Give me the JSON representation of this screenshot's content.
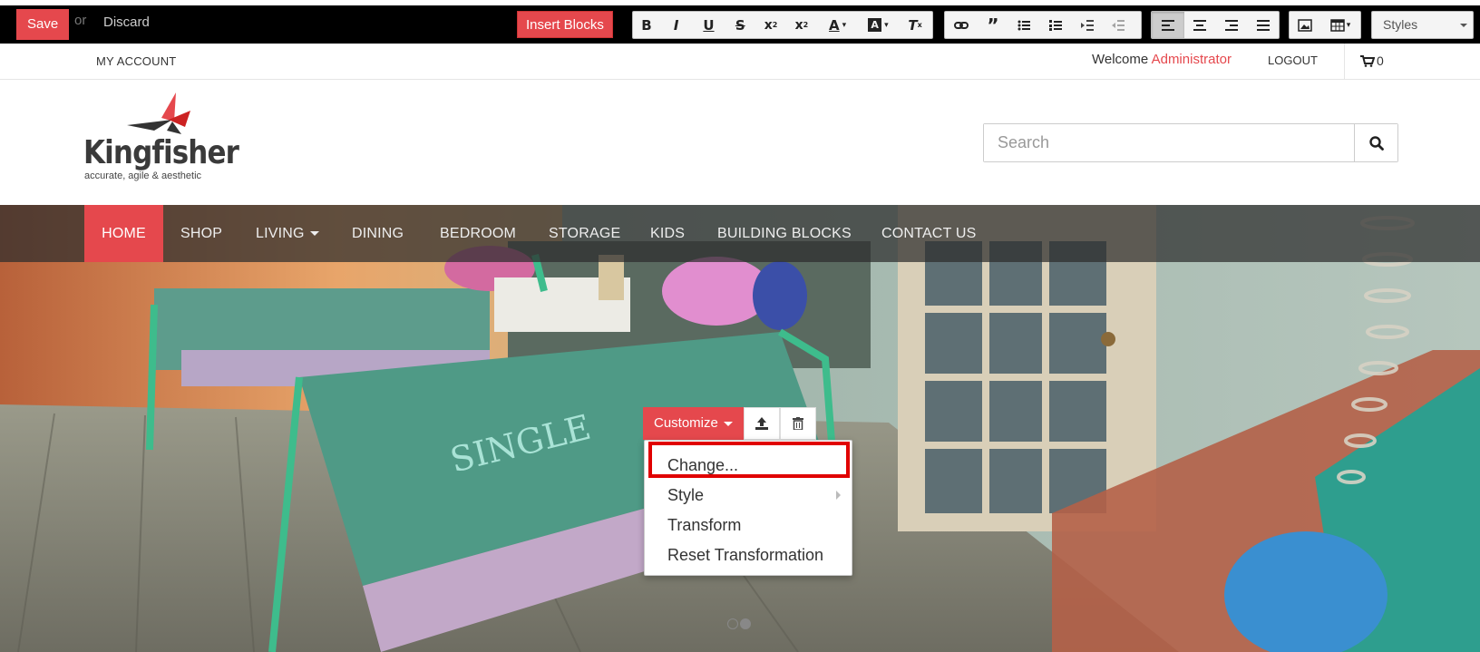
{
  "editor": {
    "save_label": "Save",
    "or_label": "or",
    "discard_label": "Discard",
    "insert_blocks_label": "Insert Blocks",
    "styles_label": "Styles",
    "format_icons": [
      "bold-icon",
      "italic-icon",
      "underline-icon",
      "strikethrough-icon",
      "subscript-icon",
      "superscript-icon",
      "font-color-icon",
      "background-color-icon",
      "remove-format-icon",
      "link-icon",
      "blockquote-icon",
      "bulleted-list-icon",
      "numbered-list-icon",
      "indent-icon",
      "outdent-icon",
      "align-left-icon",
      "align-center-icon",
      "align-right-icon",
      "justify-icon",
      "image-icon",
      "table-icon"
    ]
  },
  "account": {
    "my_account_label": "MY ACCOUNT",
    "welcome_label": "Welcome",
    "user_name": "Administrator",
    "logout_label": "LOGOUT",
    "cart_count": "0"
  },
  "brand": {
    "name": "Kingfisher",
    "tagline": "accurate, agile & aesthetic",
    "accent_color": "#e5484d"
  },
  "search": {
    "placeholder": "Search"
  },
  "nav": {
    "items": [
      {
        "label": "HOME",
        "active": true
      },
      {
        "label": "SHOP"
      },
      {
        "label": "LIVING",
        "has_dropdown": true
      },
      {
        "label": "DINING"
      },
      {
        "label": "BEDROOM"
      },
      {
        "label": "STORAGE"
      },
      {
        "label": "KIDS"
      },
      {
        "label": "BUILDING BLOCKS"
      },
      {
        "label": "CONTACT US"
      }
    ]
  },
  "customize": {
    "button_label": "Customize",
    "menu": [
      {
        "label": "Change...",
        "highlighted": true
      },
      {
        "label": "Style",
        "has_submenu": true
      },
      {
        "label": "Transform"
      },
      {
        "label": "Reset Transformation"
      }
    ]
  },
  "hero": {
    "slide_count": 2,
    "active_slide": 2
  }
}
